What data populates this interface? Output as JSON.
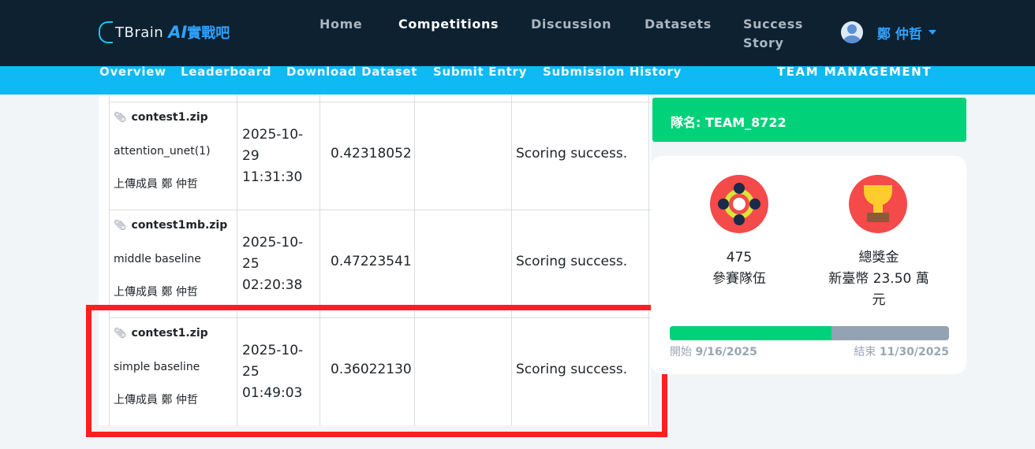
{
  "brand": {
    "text": "TBrain",
    "ai": "AI",
    "cn": "實戰吧"
  },
  "nav": {
    "home": "Home",
    "competitions": "Competitions",
    "discussion": "Discussion",
    "datasets": "Datasets",
    "success_line1": "Success",
    "success_line2": "Story"
  },
  "user": {
    "name": "鄭 仲哲"
  },
  "subnav": {
    "overview": "Overview",
    "leaderboard": "Leaderboard",
    "download": "Download Dataset",
    "submit": "Submit Entry",
    "history": "Submission History",
    "team": "TEAM MANAGEMENT"
  },
  "rows": [
    {
      "file": "contest1.zip",
      "desc": "attention_unet(1)",
      "uploader": "上傳成員 鄭 仲哲",
      "date_line1": "2025-10-",
      "date_line2": "29",
      "date_line3": "11:31:30",
      "score": "0.42318052",
      "status": "Scoring success."
    },
    {
      "file": "contest1mb.zip",
      "desc": "middle baseline",
      "uploader": "上傳成員 鄭 仲哲",
      "date_line1": "2025-10-",
      "date_line2": "25",
      "date_line3": "02:20:38",
      "score": "0.47223541",
      "status": "Scoring success."
    },
    {
      "file": "contest1.zip",
      "desc": "simple baseline",
      "uploader": "上傳成員 鄭 仲哲",
      "date_line1": "2025-10-",
      "date_line2": "25",
      "date_line3": "01:49:03",
      "score": "0.36022130",
      "status": "Scoring success."
    }
  ],
  "team": {
    "label_prefix": "隊名: ",
    "name": "TEAM_8722"
  },
  "stats": {
    "teams_count": "475",
    "teams_label": "參賽隊伍",
    "prize_label": "總獎金",
    "prize_line1": "新臺幣 23.50 萬",
    "prize_line2": "元"
  },
  "progress": {
    "fraction": 0.58,
    "start_label": "開始 ",
    "start_date": "9/16/2025",
    "end_label": "結束 ",
    "end_date": "11/30/2025"
  },
  "colors": {
    "topbar": "#0d2130",
    "subbar": "#0fb9f3",
    "accent": "#01d27a",
    "highlight": "#ff1f1f"
  }
}
